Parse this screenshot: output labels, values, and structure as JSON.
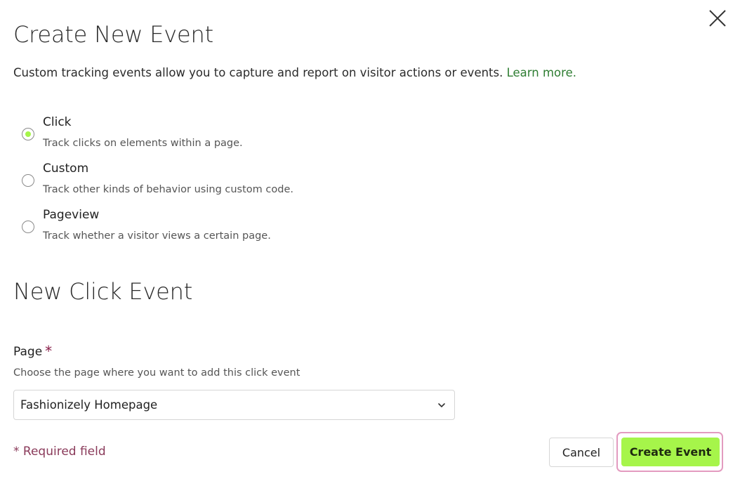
{
  "dialog": {
    "title": "Create New Event",
    "intro": "Custom tracking events allow you to capture and report on visitor actions or events.",
    "learn_more": "Learn more.",
    "close_icon": "close-icon"
  },
  "event_types": [
    {
      "label": "Click",
      "description": "Track clicks on elements within a page.",
      "selected": true
    },
    {
      "label": "Custom",
      "description": "Track other kinds of behavior using custom code.",
      "selected": false
    },
    {
      "label": "Pageview",
      "description": "Track whether a visitor views a certain page.",
      "selected": false
    }
  ],
  "section": {
    "title": "New Click Event"
  },
  "page_field": {
    "label": "Page",
    "required_marker": "*",
    "help": "Choose the page where you want to add this click event",
    "value": "Fashionizely Homepage",
    "icon": "chevron-down-icon"
  },
  "footer": {
    "required_note": "* Required field",
    "cancel_label": "Cancel",
    "create_label": "Create Event"
  },
  "colors": {
    "accent": "#a6f54a",
    "link": "#2e7d32",
    "required": "#8a3a5a",
    "focus_ring": "#e39bc0"
  }
}
